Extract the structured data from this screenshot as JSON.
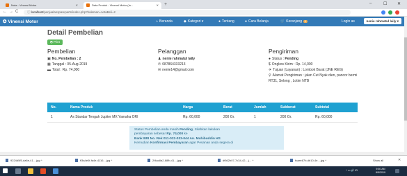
{
  "browser": {
    "tabs": [
      {
        "title": "Nota - Vinensi Motor"
      },
      {
        "title": "Data Produk - Vinensi Motor (In..."
      }
    ],
    "new_tab": "+",
    "window_controls": {
      "minimize": "–",
      "maximize": "☐",
      "close": "✕"
    },
    "nav": {
      "back": "←",
      "forward": "→",
      "reload": "C",
      "home": "⌂"
    },
    "url_host": "localhost",
    "url_path": "/penjualanspareparts/index.php?halaman=notaBeli=2"
  },
  "navbar": {
    "brand": "Vinensi Motor",
    "items": [
      {
        "label": "Beranda"
      },
      {
        "label": "Kategori"
      },
      {
        "label": "Tentang"
      },
      {
        "label": "Cara Belanja"
      },
      {
        "label": "Keranjang"
      }
    ],
    "cart_badge": "0",
    "login_label": "Login as",
    "user_name": "nenie rahmatul laily"
  },
  "page": {
    "title": "Detail Pembelian",
    "print_button": "Print"
  },
  "pembelian": {
    "heading": "Pembelian",
    "no": "No. Pembelian : 2",
    "tanggal": "Tanggal : 05-Aug-2019",
    "total": "Total : Rp. 74,000"
  },
  "pelanggan": {
    "heading": "Pelanggan",
    "name": "nenie rahmatul laily",
    "phone": "087864333213",
    "email": "nenie14@gmail.com"
  },
  "pengiriman": {
    "heading": "Pengiriman",
    "status_label": "Status : ",
    "status_value": "Pending",
    "ongkos": "Ongkos Kirim : Rp. 14,000",
    "tujuan": "Tujuan (Layanan) : Lombok Barat (JNE REG)",
    "alamat_1": "Alamat Pengiriman : jalan Cut Nyak dien, pancor bermi",
    "alamat_2": "RT31, Selong , Lotim NTB"
  },
  "table": {
    "headers": [
      "No.",
      "Nama Produk",
      "Harga",
      "Berat",
      "Jumlah",
      "Subberat",
      "Subtotal"
    ],
    "rows": [
      [
        "1",
        "As Standar Tengah Jupiter MX Yamaha ORI",
        "Rp. 60,000",
        "200 Gr.",
        "1",
        "200 Gr.",
        "Rp. 60,000"
      ]
    ]
  },
  "alert": {
    "t1": "Status Pembelian anda masih ",
    "t1b": "Pending",
    "t1c": ", Silahkan lakukan",
    "t2": "pembayaran sebesar ",
    "t2b": "Rp. 74,000",
    "t2c": " ke",
    "t3b": "Bank BRI No. Rek 011-022-033-044 An. Muhibuddin HS",
    "t4": "Kemudian ",
    "t4b": "Konfirmasi Pembayaran",
    "t4c": " agar Pesanan anda segera di"
  },
  "downloads": {
    "items": [
      {
        "name": "9224d5f5-da6e-41....jpg"
      },
      {
        "name": "ff3a4e0f-fa4e-4116....jpg"
      },
      {
        "name": "2f4ac8a2-88fb-41....jpg"
      },
      {
        "name": "df662b07-7c34-42-...j..."
      },
      {
        "name": "fcaee87b-db10-4e....jpg"
      }
    ],
    "show_all": "Show all",
    "close": "✕"
  },
  "taskbar": {
    "tray": "^ ▭ 🔊 ID",
    "time": "9:50 AM",
    "date": "8/5/2019"
  },
  "colors": {
    "navbar": "#337ab7",
    "table_header": "#1fa1d1",
    "print_button": "#5cb85c",
    "alert_bg": "#d9edf7",
    "taskbar": "#1b2b40"
  }
}
